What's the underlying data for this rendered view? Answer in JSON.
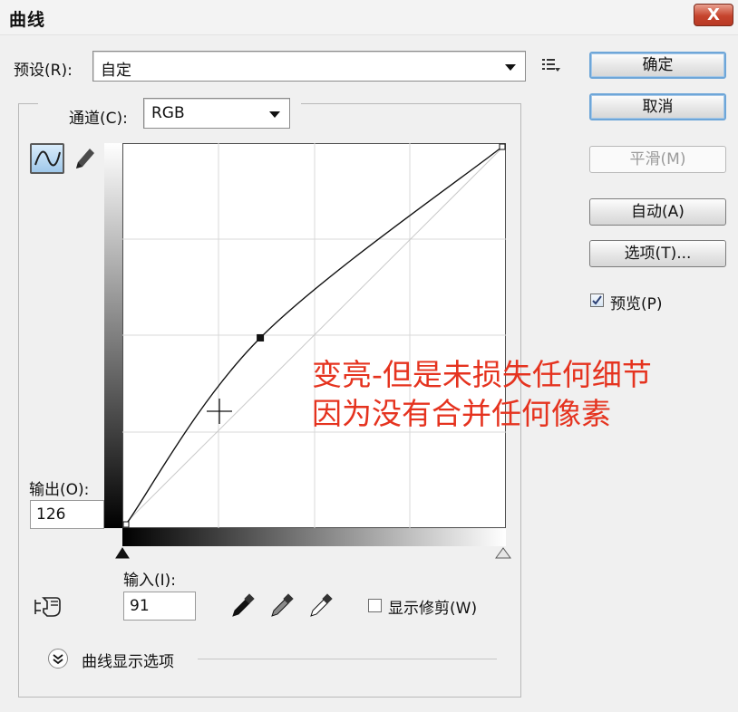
{
  "window": {
    "title": "曲线",
    "close_label": "X"
  },
  "preset": {
    "label": "预设(R):",
    "value": "自定"
  },
  "channel": {
    "label": "通道(C):",
    "value": "RGB"
  },
  "buttons": {
    "ok": "确定",
    "cancel": "取消",
    "smooth": "平滑(M)",
    "auto": "自动(A)",
    "options": "选项(T)..."
  },
  "preview": {
    "label": "预览(P)",
    "checked": true
  },
  "output": {
    "label": "输出(O):",
    "value": "126"
  },
  "input": {
    "label": "输入(I):",
    "value": "91"
  },
  "show_clipping": {
    "label": "显示修剪(W)",
    "checked": false
  },
  "curve_display_options": {
    "label": "曲线显示选项"
  },
  "annotation": {
    "line1": "变亮-但是未损失任何细节",
    "line2": "因为没有合并任何像素"
  },
  "icons": {
    "curve_tool": "curve-tool-icon",
    "pencil_tool": "pencil-icon",
    "preset_menu": "preset-menu-icon",
    "hand_tool": "target-adjust-hand-icon",
    "eyedroppers": [
      "black-eyedropper-icon",
      "gray-eyedropper-icon",
      "white-eyedropper-icon"
    ],
    "expand": "expand-chevron-icon"
  },
  "curve": {
    "input_range": [
      0,
      255
    ],
    "output_range": [
      0,
      255
    ],
    "points": [
      {
        "input": 0,
        "output": 0
      },
      {
        "input": 91,
        "output": 126
      },
      {
        "input": 255,
        "output": 255
      }
    ]
  },
  "colors": {
    "annotation": "#e5331f",
    "primary_button_border": "#6ea6d8"
  }
}
